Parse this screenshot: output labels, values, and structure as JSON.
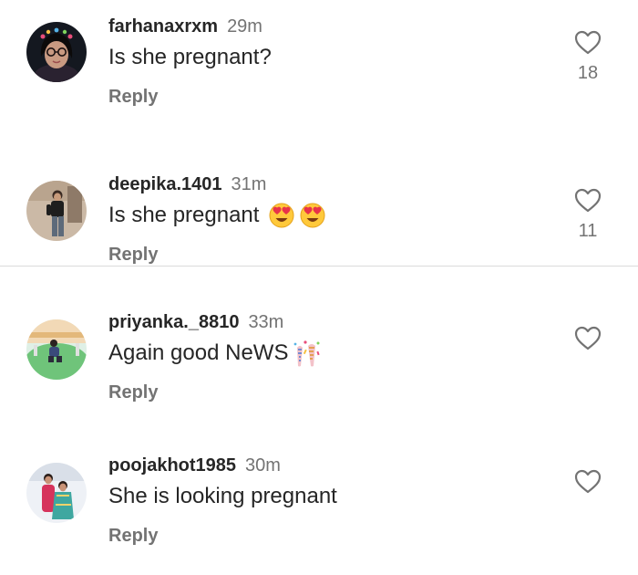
{
  "comments": [
    {
      "username": "farhanaxrxm",
      "time": "29m",
      "text": "Is she pregnant?",
      "reply_label": "Reply",
      "likes": "18",
      "emojis": []
    },
    {
      "username": "deepika.1401",
      "time": "31m",
      "text": "Is she pregnant",
      "reply_label": "Reply",
      "likes": "11",
      "emojis": [
        "heart-eyes-emoji",
        "heart-eyes-emoji"
      ]
    },
    {
      "username": "priyanka._8810",
      "time": "33m",
      "text": "Again good NeWS",
      "reply_label": "Reply",
      "likes": "",
      "emojis": [
        "confetti-ball-emoji"
      ]
    },
    {
      "username": "poojakhot1985",
      "time": "30m",
      "text": "She is looking pregnant",
      "reply_label": "Reply",
      "likes": "",
      "emojis": []
    }
  ],
  "icons": {
    "like": "heart-outline-icon"
  },
  "colors": {
    "text": "#262626",
    "secondary": "#737373",
    "divider": "#dbdbdb",
    "background": "#ffffff"
  }
}
